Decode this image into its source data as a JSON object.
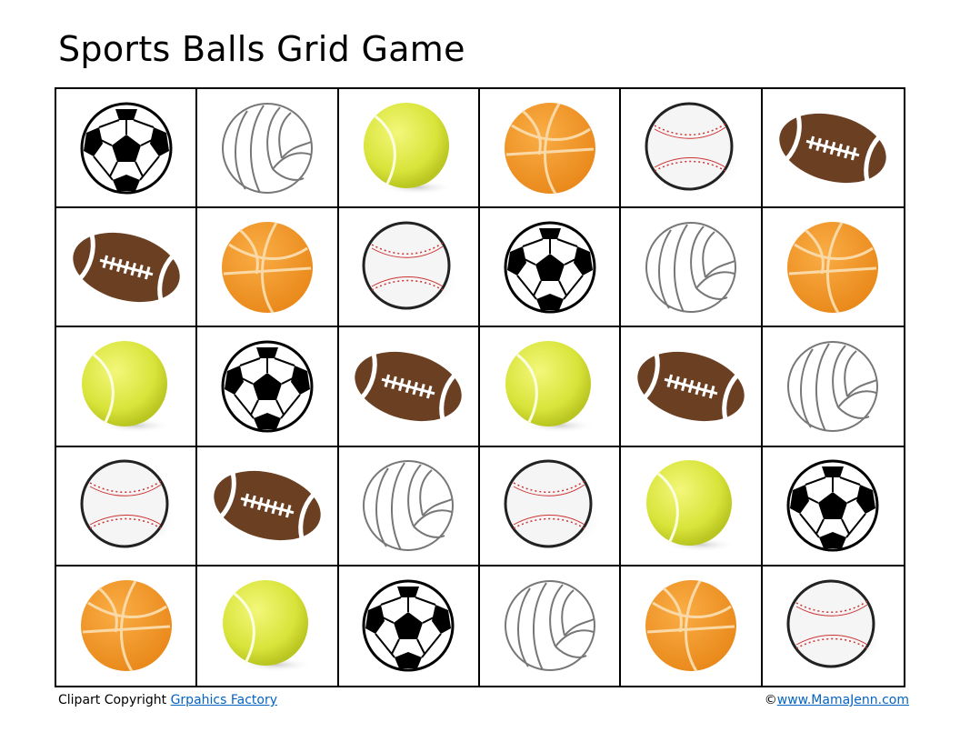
{
  "title": "Sports Balls Grid Game",
  "grid": [
    [
      "soccer",
      "volleyball",
      "tennis",
      "basketball",
      "baseball",
      "football"
    ],
    [
      "football",
      "basketball",
      "baseball",
      "soccer",
      "volleyball",
      "basketball"
    ],
    [
      "tennis",
      "soccer",
      "football",
      "tennis",
      "football",
      "volleyball"
    ],
    [
      "baseball",
      "football",
      "volleyball",
      "baseball",
      "tennis",
      "soccer"
    ],
    [
      "basketball",
      "tennis",
      "soccer",
      "volleyball",
      "basketball",
      "baseball"
    ]
  ],
  "footer": {
    "credit_prefix": "Clipart Copyright",
    "credit_link": "Grpahics Factory",
    "copyright_symbol": "©",
    "site_link": "www.MamaJenn.com"
  },
  "colors": {
    "link": "#0563c1",
    "basketball": "#f39a2b",
    "football": "#6b3f22",
    "tennis": "#d8e43a"
  }
}
